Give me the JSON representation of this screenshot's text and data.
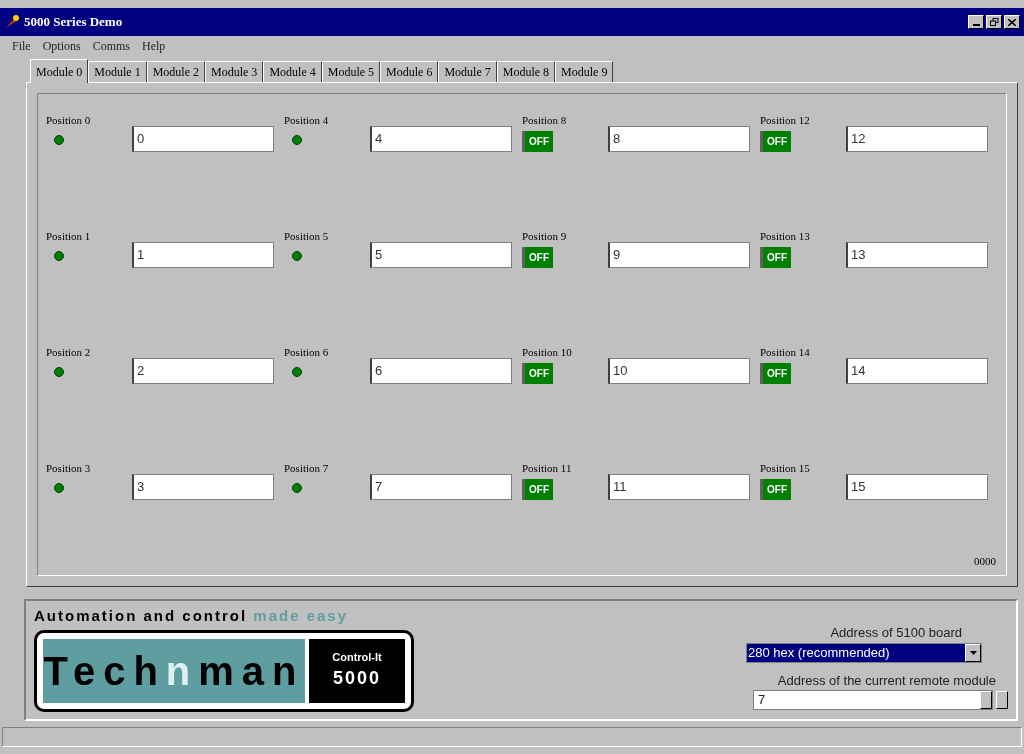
{
  "window": {
    "title": "5000 Series Demo"
  },
  "menu": [
    "File",
    "Options",
    "Comms",
    "Help"
  ],
  "tabs": [
    {
      "label": "Module 0",
      "selected": true
    },
    {
      "label": "Module 1",
      "selected": false
    },
    {
      "label": "Module 2",
      "selected": false
    },
    {
      "label": "Module 3",
      "selected": false
    },
    {
      "label": "Module 4",
      "selected": false
    },
    {
      "label": "Module 5",
      "selected": false
    },
    {
      "label": "Module 6",
      "selected": false
    },
    {
      "label": "Module 7",
      "selected": false
    },
    {
      "label": "Module 8",
      "selected": false
    },
    {
      "label": "Module 9",
      "selected": false
    }
  ],
  "columns": [
    {
      "positions": [
        {
          "label": "Position 0",
          "kind": "led",
          "on": true,
          "value": "0"
        },
        {
          "label": "Position 1",
          "kind": "led",
          "on": true,
          "value": "1"
        },
        {
          "label": "Position 2",
          "kind": "led",
          "on": true,
          "value": "2"
        },
        {
          "label": "Position 3",
          "kind": "led",
          "on": true,
          "value": "3"
        }
      ]
    },
    {
      "positions": [
        {
          "label": "Position 4",
          "kind": "led",
          "on": true,
          "value": "4"
        },
        {
          "label": "Position 5",
          "kind": "led",
          "on": true,
          "value": "5"
        },
        {
          "label": "Position 6",
          "kind": "led",
          "on": true,
          "value": "6"
        },
        {
          "label": "Position 7",
          "kind": "led",
          "on": true,
          "value": "7"
        }
      ]
    },
    {
      "positions": [
        {
          "label": "Position 8",
          "kind": "switch",
          "on": false,
          "switch_text": "OFF",
          "value": "8"
        },
        {
          "label": "Position 9",
          "kind": "switch",
          "on": false,
          "switch_text": "OFF",
          "value": "9"
        },
        {
          "label": "Position 10",
          "kind": "switch",
          "on": false,
          "switch_text": "OFF",
          "value": "10"
        },
        {
          "label": "Position 11",
          "kind": "switch",
          "on": false,
          "switch_text": "OFF",
          "value": "11"
        }
      ]
    },
    {
      "positions": [
        {
          "label": "Position 12",
          "kind": "switch",
          "on": false,
          "switch_text": "OFF",
          "value": "12"
        },
        {
          "label": "Position 13",
          "kind": "switch",
          "on": false,
          "switch_text": "OFF",
          "value": "13"
        },
        {
          "label": "Position 14",
          "kind": "switch",
          "on": false,
          "switch_text": "OFF",
          "value": "14"
        },
        {
          "label": "Position 15",
          "kind": "switch",
          "on": false,
          "switch_text": "OFF",
          "value": "15"
        }
      ]
    }
  ],
  "panel_code": "0000",
  "logo": {
    "tagline": "Automation and control",
    "tagline_accent": "made easy",
    "brand_parts": [
      "Tech",
      "n",
      "man"
    ],
    "product": "Control-It",
    "model": "5000"
  },
  "board_address": {
    "label": "Address of 5100 board",
    "value": "280 hex (recommended)"
  },
  "module_address": {
    "label": "Address of the current remote module",
    "value": "7"
  }
}
